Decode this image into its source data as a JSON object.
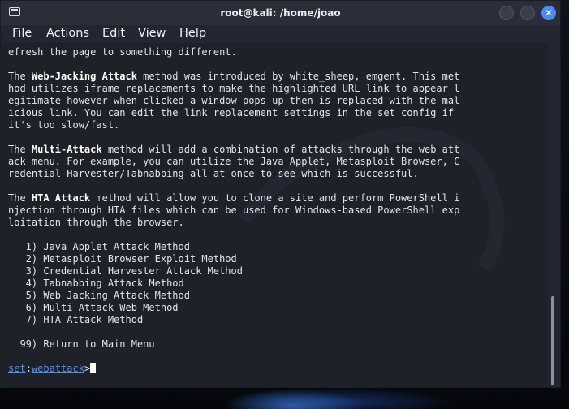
{
  "window": {
    "title": "root@kali: /home/joao",
    "close_glyph": "✕"
  },
  "menu": [
    "File",
    "Actions",
    "Edit",
    "View",
    "Help"
  ],
  "terminal": {
    "line_0": "efresh the page to something different.",
    "webjack_bold": "Web-Jacking Attack",
    "webjack_1": "The ",
    "webjack_2": " method was introduced by white_sheep, emgent. This met",
    "webjack_3": "hod utilizes iframe replacements to make the highlighted URL link to appear l",
    "webjack_4": "egitimate however when clicked a window pops up then is replaced with the mal",
    "webjack_5": "icious link. You can edit the link replacement settings in the set_config if",
    "webjack_6": "it's too slow/fast.",
    "multi_bold": "Multi-Attack",
    "multi_1": "The ",
    "multi_2": " method will add a combination of attacks through the web att",
    "multi_3": "ack menu. For example, you can utilize the Java Applet, Metasploit Browser, C",
    "multi_4": "redential Harvester/Tabnabbing all at once to see which is successful.",
    "hta_bold": "HTA Attack",
    "hta_1": "The ",
    "hta_2": " method will allow you to clone a site and perform PowerShell i",
    "hta_3": "njection through HTA files which can be used for Windows-based PowerShell exp",
    "hta_4": "loitation through the browser.",
    "options": [
      "   1) Java Applet Attack Method",
      "   2) Metasploit Browser Exploit Method",
      "   3) Credential Harvester Attack Method",
      "   4) Tabnabbing Attack Method",
      "   5) Web Jacking Attack Method",
      "   6) Multi-Attack Web Method",
      "   7) HTA Attack Method"
    ],
    "return_option": "  99) Return to Main Menu",
    "prompt_set": "set",
    "prompt_colon": ":",
    "prompt_module": "webattack",
    "prompt_gt": ">"
  },
  "colors": {
    "prompt": "#4d8ff5",
    "close_button": "#4a8cf7"
  }
}
